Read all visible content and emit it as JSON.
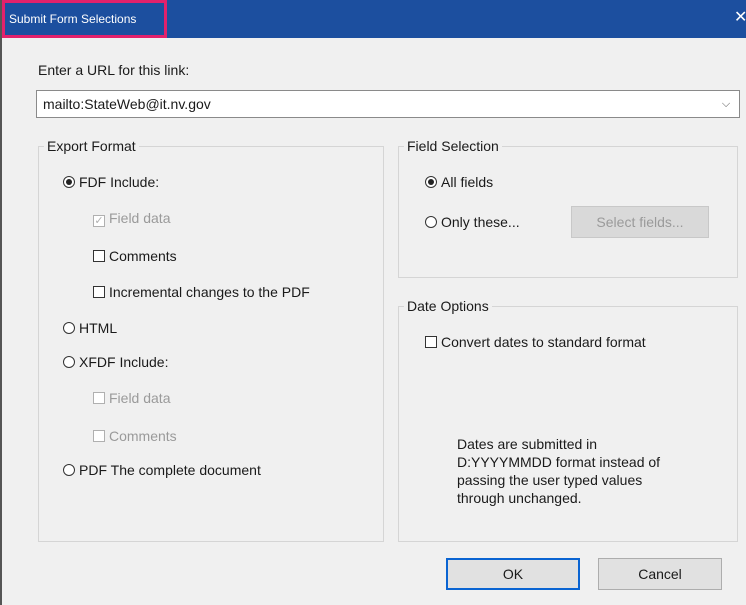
{
  "window": {
    "title": "Submit Form Selections",
    "close_glyph": "✕"
  },
  "url": {
    "label": "Enter a URL for this link:",
    "value": "mailto:StateWeb@it.nv.gov",
    "dropdown_glyph": "⌵"
  },
  "export_format": {
    "title": "Export Format",
    "fdf_label": "FDF  Include:",
    "fdf_field_data": "Field data",
    "fdf_comments": "Comments",
    "fdf_incremental": "Incremental changes to the PDF",
    "html_label": "HTML",
    "xfdf_label": "XFDF  Include:",
    "xfdf_field_data": "Field data",
    "xfdf_comments": "Comments",
    "pdf_label": "PDF  The complete document",
    "selected": "FDF"
  },
  "field_selection": {
    "title": "Field Selection",
    "all_fields": "All fields",
    "only_these": "Only these...",
    "select_fields_button": "Select fields...",
    "selected": "All fields"
  },
  "date_options": {
    "title": "Date Options",
    "convert_label": "Convert dates to standard format",
    "note_line1": "Dates are submitted in",
    "note_line2": "D:YYYYMMDD format instead of",
    "note_line3": "passing the user typed values",
    "note_line4": "through unchanged."
  },
  "buttons": {
    "ok": "OK",
    "cancel": "Cancel"
  },
  "colors": {
    "titlebar": "#1c4f9f",
    "highlight_border": "#e2216c"
  }
}
